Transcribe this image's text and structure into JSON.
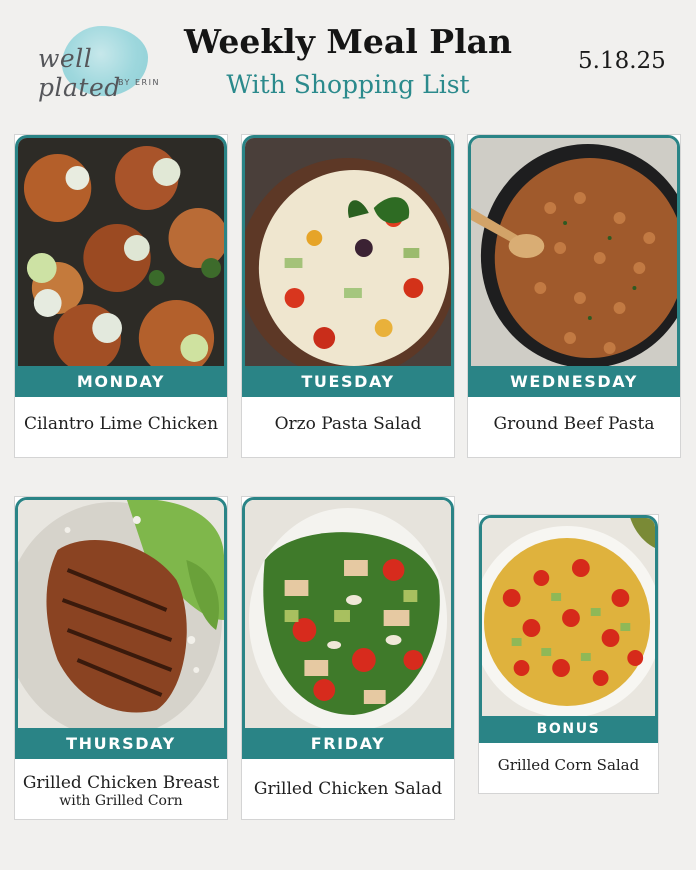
{
  "logo": {
    "wordmark": "well plated",
    "byline": "BY ERIN"
  },
  "header": {
    "title": "Weekly Meal Plan",
    "subtitle": "With Shopping List",
    "date": "5.18.25"
  },
  "days": [
    {
      "day": "MONDAY",
      "meal": "Cilantro Lime Chicken",
      "meal_line2": ""
    },
    {
      "day": "TUESDAY",
      "meal": "Orzo Pasta Salad",
      "meal_line2": ""
    },
    {
      "day": "WEDNESDAY",
      "meal": "Ground Beef Pasta",
      "meal_line2": ""
    },
    {
      "day": "THURSDAY",
      "meal": "Grilled Chicken Breast",
      "meal_line2": "with Grilled Corn"
    },
    {
      "day": "FRIDAY",
      "meal": "Grilled Chicken Salad",
      "meal_line2": ""
    },
    {
      "day": "BONUS",
      "meal": "Grilled Corn Salad",
      "meal_line2": ""
    }
  ],
  "colors": {
    "accent": "#2a8486",
    "subtitle": "#2b8a8c",
    "background": "#f1f0ee"
  }
}
